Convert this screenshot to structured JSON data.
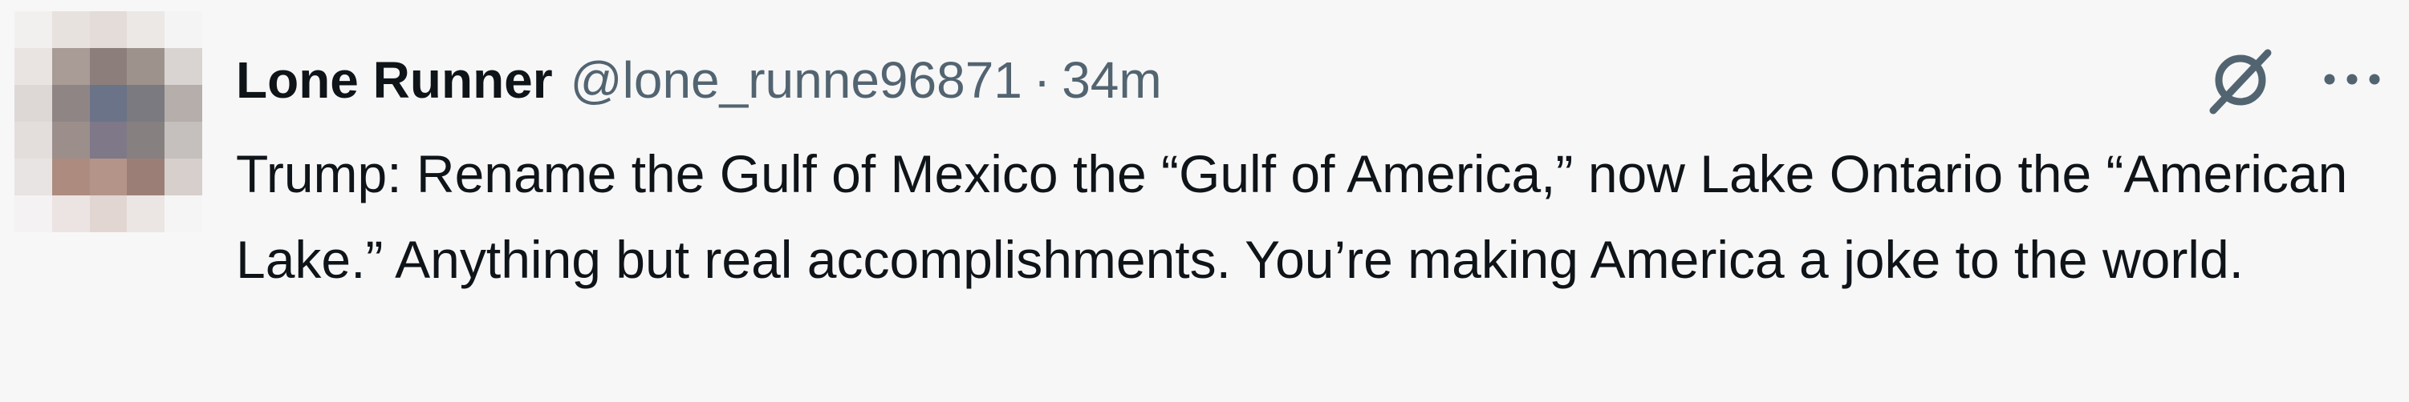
{
  "tweet": {
    "display_name": "Lone Runner",
    "handle": "@lone_runne96871",
    "separator": "·",
    "time": "34m",
    "text": "Trump: Rename the Gulf of Mexico the “Gulf of America,” now Lake Ontario the “American Lake.” Anything but real accomplishments. You’re making America a joke to the world."
  },
  "icons": {
    "avatar": "pixelated-avatar",
    "grok": "grok-icon",
    "more": "more-icon"
  },
  "colors": {
    "background": "#f7f7f7",
    "text_primary": "#0f1419",
    "text_secondary": "#536471"
  }
}
